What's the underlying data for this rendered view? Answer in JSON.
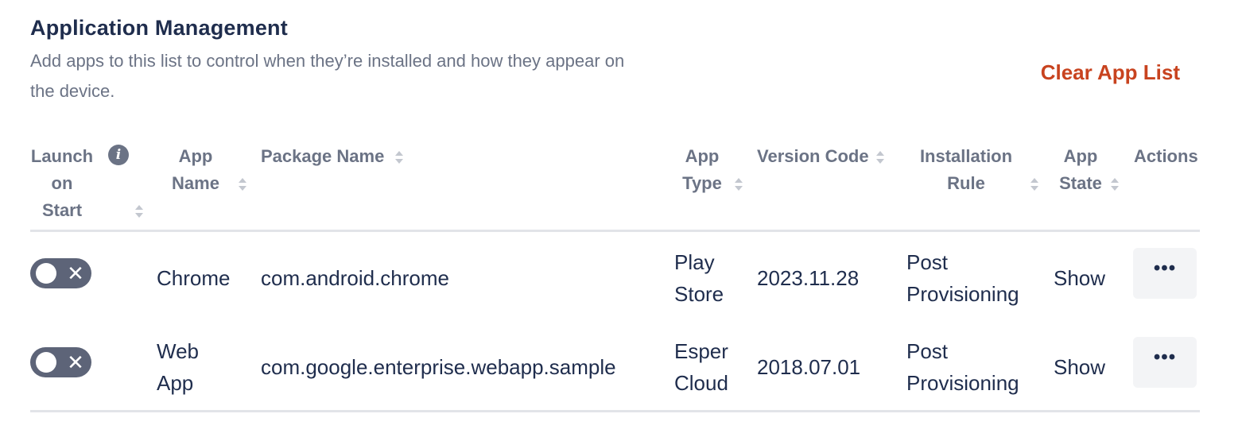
{
  "header": {
    "title": "Application Management",
    "description": "Add apps to this list to control when they’re installed and how they appear on the device.",
    "clear_button": "Clear App List"
  },
  "columns": {
    "launch": [
      "Launch",
      "on",
      "Start"
    ],
    "app_name": [
      "App",
      "Name"
    ],
    "package_name": "Package Name",
    "app_type": [
      "App",
      "Type"
    ],
    "version_code": "Version Code",
    "install_rule": [
      "Installation",
      "Rule"
    ],
    "app_state": [
      "App",
      "State"
    ],
    "actions": "Actions"
  },
  "info_icon_glyph": "i",
  "rows": [
    {
      "launch_on_start": false,
      "app_name": [
        "Chrome"
      ],
      "package_name": "com.android.chrome",
      "app_type": [
        "Play",
        "Store"
      ],
      "version_code": "2023.11.28",
      "install_rule": [
        "Post",
        "Provisioning"
      ],
      "app_state": "Show",
      "actions_glyph": "•••"
    },
    {
      "launch_on_start": false,
      "app_name": [
        "Web",
        "App"
      ],
      "package_name": "com.google.enterprise.webapp.sample",
      "app_type": [
        "Esper",
        "Cloud"
      ],
      "version_code": "2018.07.01",
      "install_rule": [
        "Post",
        "Provisioning"
      ],
      "app_state": "Show",
      "actions_glyph": "•••"
    }
  ],
  "toggle_glyph": "✕",
  "colors": {
    "accent_danger": "#c8431f",
    "toggle_off": "#5d6478",
    "header_text": "#6b7385",
    "body_text": "#1f2d4d"
  }
}
